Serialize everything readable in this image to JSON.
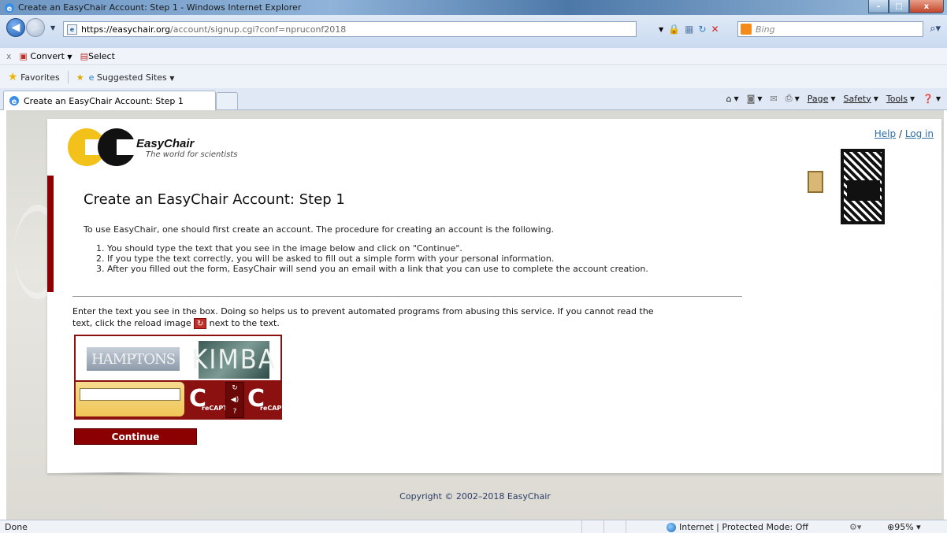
{
  "window": {
    "title": "Create an EasyChair Account: Step 1 - Windows Internet Explorer",
    "min_label": "–",
    "max_label": "□",
    "close_label": "x"
  },
  "address_bar": {
    "url_host": "https://easychair.org",
    "url_path": "/account/signup.cgi?conf=npruconf2018",
    "search_placeholder": "Bing"
  },
  "command_bar": {
    "convert_label": "Convert",
    "select_label": "Select"
  },
  "favorites_bar": {
    "favorites_label": "Favorites",
    "suggested_label": "Suggested Sites"
  },
  "tabs": [
    {
      "label": "Create an EasyChair Account: Step 1"
    }
  ],
  "toolbar": {
    "page_label": "Page",
    "safety_label": "Safety",
    "tools_label": "Tools"
  },
  "page": {
    "brand_name": "EasyChair",
    "tagline": "The world for scientists",
    "help_link": "Help",
    "link_sep": "/",
    "login_link": "Log in",
    "heading": "Create an EasyChair Account: Step 1",
    "intro": "To use EasyChair, one should first create an account. The procedure for creating an account is the following.",
    "steps": [
      "1. You should type the text that you see in the image below and click on \"Continue\".",
      "2. If you type the text correctly, you will be asked to fill out a simple form with your personal information.",
      "3. After you filled out the form, EasyChair will send you an email with a link that you can use to complete the account creation."
    ],
    "instruction_part1": "Enter the text you see in the box. Doing so helps us to prevent automated programs from abusing this service. If you cannot read the text, click the reload image",
    "instruction_part2": "next to the text.",
    "captcha_word1": "HAMPTONS",
    "captcha_word2": "KIMBA",
    "recaptcha_label1": "reCAPTC",
    "recaptcha_label2": "reCAP",
    "continue_label": "Continue",
    "copyright": "Copyright © 2002–2018 EasyChair"
  },
  "status_bar": {
    "status_text": "Done",
    "zone_text": "Internet | Protected Mode: Off",
    "zoom_text": "95%"
  },
  "colors": {
    "accent_red": "#8b0000",
    "link_blue": "#2d6ea3",
    "captcha_yellow": "#f0c657"
  }
}
